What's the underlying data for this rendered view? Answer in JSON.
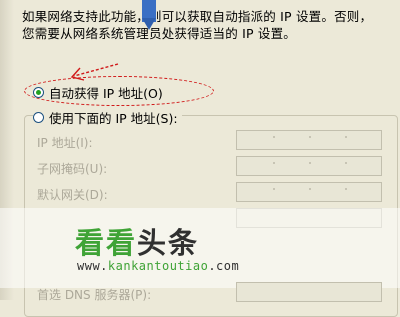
{
  "description": {
    "line1": "如果网络支持此功能，则可以获取自动指派的 IP 设置。否则，",
    "line2": "您需要从网络系统管理员处获得适当的 IP 设置。"
  },
  "options": {
    "auto": "自动获得 IP 地址(O)",
    "manual": "使用下面的 IP 地址(S):"
  },
  "fields": {
    "ip": "IP 地址(I):",
    "subnet": "子网掩码(U):",
    "gateway": "默认网关(D):",
    "dns": "首选 DNS 服务器(P):"
  },
  "watermark": {
    "brand_green": "看看",
    "brand_dark": "头条",
    "url_prefix": "www.",
    "url_green": "kankantoutiao",
    "url_suffix": ".com"
  },
  "colors": {
    "annotation": "#d01818",
    "brand_green": "#3fa336"
  }
}
